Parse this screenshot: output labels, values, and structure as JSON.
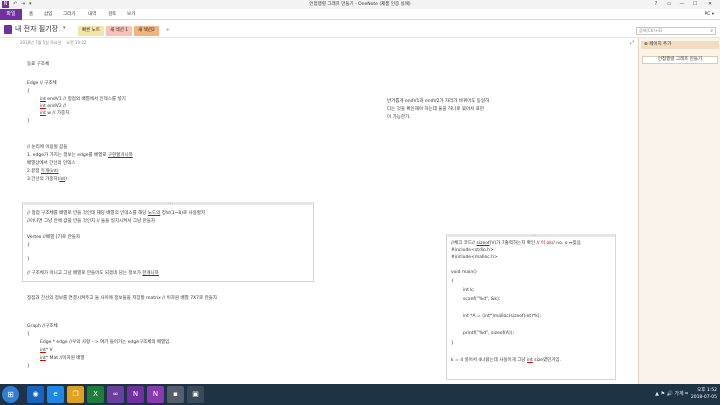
{
  "window": {
    "title": "인접행렬 그래프 만들기 - OneNote (제품 인증 실패)",
    "app_icon": "N",
    "quick_access": [
      "↶",
      "⇥",
      "▾"
    ],
    "controls": [
      "?",
      "▭",
      "—",
      "☐",
      "✕"
    ]
  },
  "ribbon": {
    "file": "파일",
    "tabs": [
      "홈",
      "삽입",
      "그리기",
      "내역",
      "검토",
      "보기"
    ],
    "user": "PC ▾"
  },
  "notebook": {
    "name": "내 전자 필기장",
    "caret": "▾",
    "sections": [
      {
        "label": "빠른 노트",
        "color": "#f6e3a8"
      },
      {
        "label": "새 섹션 1",
        "color": "#f7c3b7"
      },
      {
        "label": "새 섹션2",
        "color": "#f2b37c"
      }
    ],
    "add_section": "+",
    "search_placeholder": "검색(Ctrl+E)",
    "search_icon": "⌕"
  },
  "page": {
    "date": "2018년 7월 5일 목요일",
    "time": "오전 10:22",
    "expand_icon": "⤢",
    "lines": {
      "l1": "동료 구조체",
      "l2": "Edge // 구조체",
      "l3": "{",
      "l4a": "int",
      "l4b": " endV1 // 정점의 배열에서 인덱스를 넣기",
      "l5a": "int",
      "l5b": " endV2 //",
      "l6a": "int",
      "l6b": " w // 가중치",
      "l7": "}",
      "l8": "// 논리에 이용될 값들",
      "l9a": "1. edge가 가지는 정보는 edge를 배열로 ",
      "l9b": "구현할거니까",
      "l10": "배열상에서 간선의 인덱스",
      "l11a": "2.끝점 ",
      "l11b": "두개(int)",
      "l12a": "3.간선의 가중치(",
      "l12b": "int",
      "l12c": ")",
      "note1": "반가롭게 endV1과 endV2가 자리가 바뀌어도 동일하",
      "note2": "다는 것을 확인해야 하는데 둘을 하나로 묶어서 표현",
      "note3": "이 가능한가.",
      "m1": "정점과 간선의 정보를 연결시켜주고 둘 사이에 정보들을 저장할 matrix // 이차원 배열  7X7로 만들자",
      "g1": "Graph //구조체",
      "g2": "{",
      "g3": "Edge * edge          //우의 사항 --> 여기 들어가는 edge구조체의 배열임.",
      "g4a": "int",
      "g4b": "* V",
      "g5a": "int",
      "g5b": "* Mat      //이차원 배열",
      "g6": "}"
    },
    "box1": {
      "b1a": "// 정점 구조체를 배열로 만들 것인데 해당 배열의 인덱스를 해당 ",
      "b1b": "노드의",
      "b1c": " 정보(1~8)로 사용할지",
      "b2": "//아니면  그냥 안에 값을 만들 것인지  // 둘을 일치시켜서 그냥 만들자",
      "b3": "Vertex  //배열 [7]로 만들자",
      "b4": "{",
      "b5": "}",
      "b6a": "// 구조체가 아니고 그냥 배열로 만들어도 되겠네 담는 정보가 ",
      "b6b": "한개니까"
    },
    "box2": {
      "c1a": "//체크 코드// ",
      "c1b": "sizeof",
      "c1c": "(V)가 7출력하는지 확인 // ",
      "c1d": "이 ok",
      "c1e": "// no. o ↔맞음",
      "c2": "#include<stdio.h>",
      "c3": "#include<malloc.h>",
      "c4": "void main()",
      "c5": "{",
      "c6": "int k;",
      "c7": "scanf(\"%d\", &k);",
      "c8": "int *A = (int*)malloc(sizeof(int)*k);",
      "c9": "printf(\"%d\", sizeof(A));",
      "c10": "}",
      "c11a": "k = 4 넣어서 4나왔는데 사실이게 그냥 ",
      "c11b": "int",
      "c11c": " size였던거임."
    }
  },
  "panel": {
    "add_page": "⊕ 페이지 추가",
    "page_item": "인접행렬 그래프 만들기"
  },
  "taskbar": {
    "start": "⊞",
    "apps": [
      {
        "glyph": "◉",
        "color": "#1565c0"
      },
      {
        "glyph": "e",
        "color": "#1e88e5"
      },
      {
        "glyph": "❐",
        "color": "#e0a020"
      },
      {
        "glyph": "X",
        "color": "#1e7d3a"
      },
      {
        "glyph": "∞",
        "color": "#6a3fa0"
      },
      {
        "glyph": "N",
        "color": "#7030a0"
      },
      {
        "glyph": "N",
        "color": "#8a3ab0"
      },
      {
        "glyph": "▪",
        "color": "#555e6a"
      },
      {
        "glyph": "▣",
        "color": "#3a4a5a"
      }
    ],
    "tray": "▲ ⚑ 🔊 가계 ⌗",
    "time": "오후 1:52",
    "date": "2018-07-05"
  }
}
